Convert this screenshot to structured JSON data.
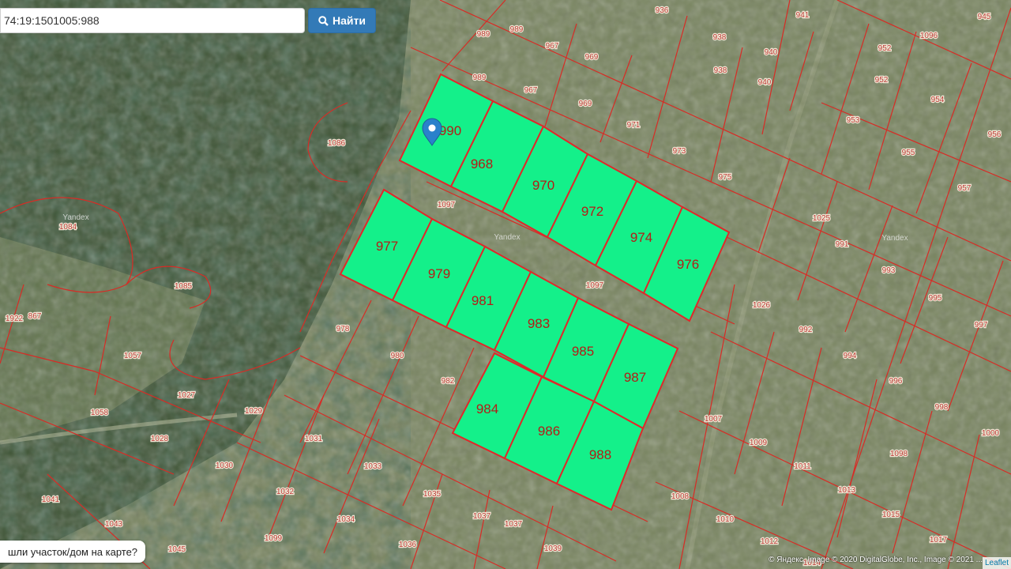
{
  "search": {
    "value": "74:19:1501005:988",
    "button_label": "Найти",
    "button_icon": "search-icon"
  },
  "help_text": "шли участок/дом на карте?",
  "attribution": "© Яндекс, Image © 2020 DigitalGlobe, Inc., Image © 2021 ...",
  "leaflet_label": "Leaflet",
  "marker_icon": "map-marker-icon",
  "colors": {
    "parcel_border": "#e0282a",
    "highlight_fill": "#14f08a",
    "label_text": "#b93d37",
    "button": "#337ab7",
    "marker": "#2a81cb"
  },
  "watermarks": [
    "Yandex",
    "Yandex",
    "Yandex"
  ],
  "highlighted_parcels": [
    "990",
    "968",
    "970",
    "972",
    "974",
    "976",
    "977",
    "979",
    "981",
    "983",
    "985",
    "987",
    "984",
    "986",
    "988"
  ],
  "parcel_labels": [
    "936",
    "941",
    "945",
    "989",
    "989",
    "967",
    "969",
    "938",
    "940",
    "1096",
    "952",
    "952",
    "938",
    "940",
    "989",
    "967",
    "969",
    "954",
    "953",
    "956",
    "1086",
    "971",
    "973",
    "955",
    "975",
    "957",
    "1097",
    "1025",
    "991",
    "1084",
    "1085",
    "1097",
    "993",
    "995",
    "1026",
    "867",
    "1922",
    "978",
    "992",
    "997",
    "1057",
    "980",
    "994",
    "982",
    "996",
    "1027",
    "1058",
    "1029",
    "1007",
    "998",
    "1028",
    "1031",
    "1009",
    "1098",
    "1000",
    "1030",
    "1033",
    "1011",
    "1032",
    "1035",
    "1041",
    "1013",
    "1008",
    "1037",
    "1034",
    "1010",
    "1015",
    "1043",
    "1099",
    "1037",
    "1036",
    "1039",
    "1012",
    "1017",
    "1045",
    "1014"
  ]
}
